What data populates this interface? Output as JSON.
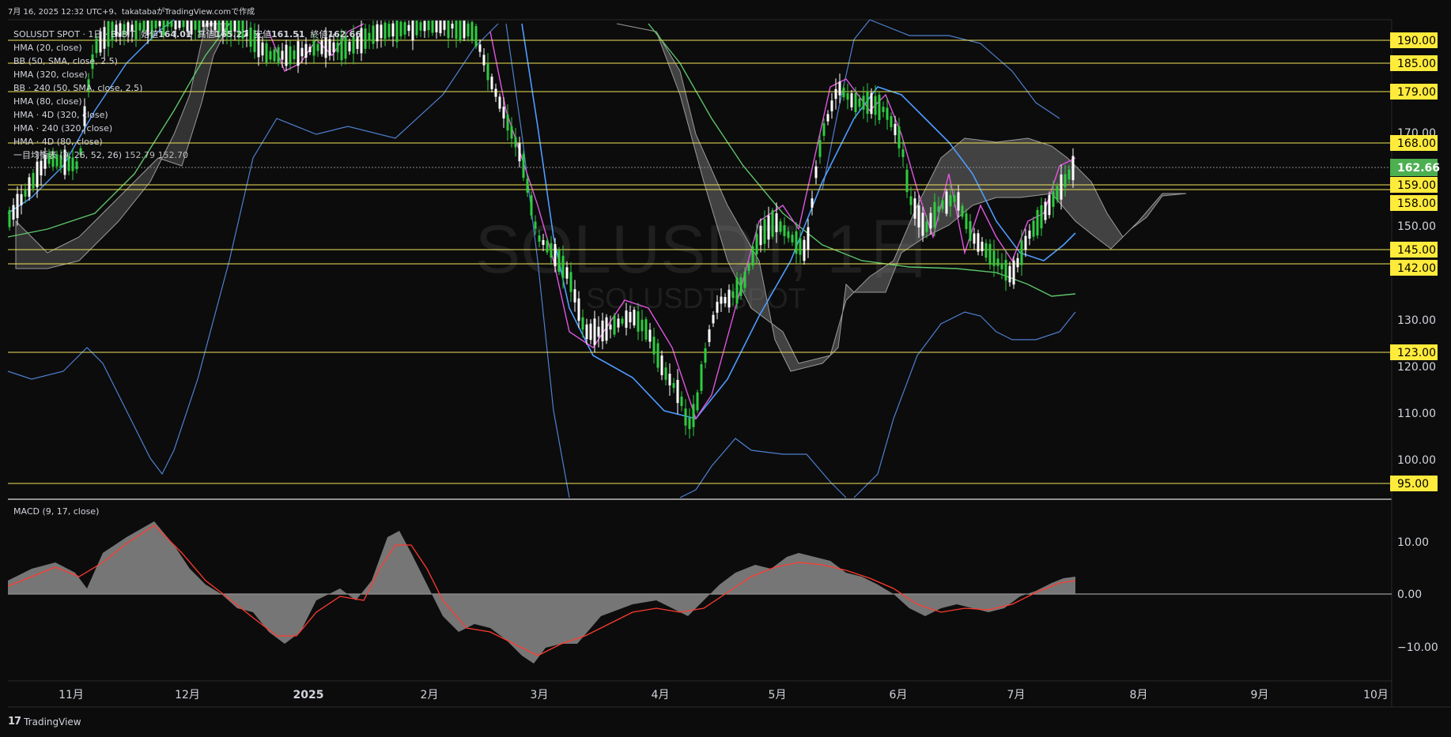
{
  "header_line": "7月 16, 2025 12:32 UTC+9、takatabaがTradingView.comで作成",
  "symbol_line": {
    "symbol": "SOLUSDT SPOT · 1日 · BYBIT",
    "open_label": "始値",
    "open": "164.01",
    "high_label": "高値",
    "high": "165.27",
    "low_label": "安値",
    "low": "161.51",
    "close_label": "終値",
    "close": "162.66"
  },
  "indicators": [
    "HMA (20, close)",
    "BB (50, SMA, close, 2.5)",
    "HMA (320, close)",
    "BB · 240 (50, SMA, close, 2.5)",
    "HMA (80, close)",
    "HMA · 4D (320, close)",
    "HMA · 240 (320, close)",
    "HMA · 4D (80, close)"
  ],
  "ichimoku": {
    "label": "一目均衡表 (9, 26, 52, 26)",
    "v1": "152.79",
    "v2": "152.70"
  },
  "watermark": {
    "main": "SOLUSDT, 1日",
    "sub": "SOLUSDT SPOT"
  },
  "macd_label": "MACD (9, 17, close)",
  "price_axis": {
    "ticks": [
      "170.00",
      "150.00",
      "130.00",
      "120.00",
      "110.00",
      "100.00"
    ],
    "levels": [
      "190.00",
      "185.00",
      "179.00",
      "168.00",
      "159.00",
      "158.00",
      "145.00",
      "142.00",
      "123.00",
      "95.00"
    ],
    "last_price": "162.66"
  },
  "macd_axis": {
    "ticks": [
      "10.00",
      "0.00",
      "−10.00"
    ]
  },
  "time_axis": [
    "11月",
    "12月",
    "2025",
    "2月",
    "3月",
    "4月",
    "5月",
    "6月",
    "7月",
    "8月",
    "9月",
    "10月"
  ],
  "footer": {
    "brand": "TradingView"
  },
  "colors": {
    "background": "#0c0c0c",
    "level_line": "#f1e35a",
    "label_bg": "#ffeb3b",
    "last_price_bg": "#4caf50",
    "hma_fast": "#e056e0",
    "hma_mid": "#4e9cff",
    "hma_slow": "#5cc46a",
    "cloud": "#7a7a7a",
    "macd_hist": "#8a8a8a",
    "macd_signal": "#ff3b30",
    "candle_up": "#2ecc40",
    "candle_down": "#ffffff"
  },
  "chart_data": {
    "type": "candlestick",
    "y_range": [
      88,
      198
    ],
    "horizontal_levels": [
      190,
      185,
      179,
      168,
      159,
      158,
      145,
      142,
      123,
      95
    ],
    "last_price": 162.66,
    "ohlc_last": {
      "open": 164.01,
      "high": 165.27,
      "low": 161.51,
      "close": 162.66
    },
    "macd_range": [
      -14,
      14
    ]
  }
}
